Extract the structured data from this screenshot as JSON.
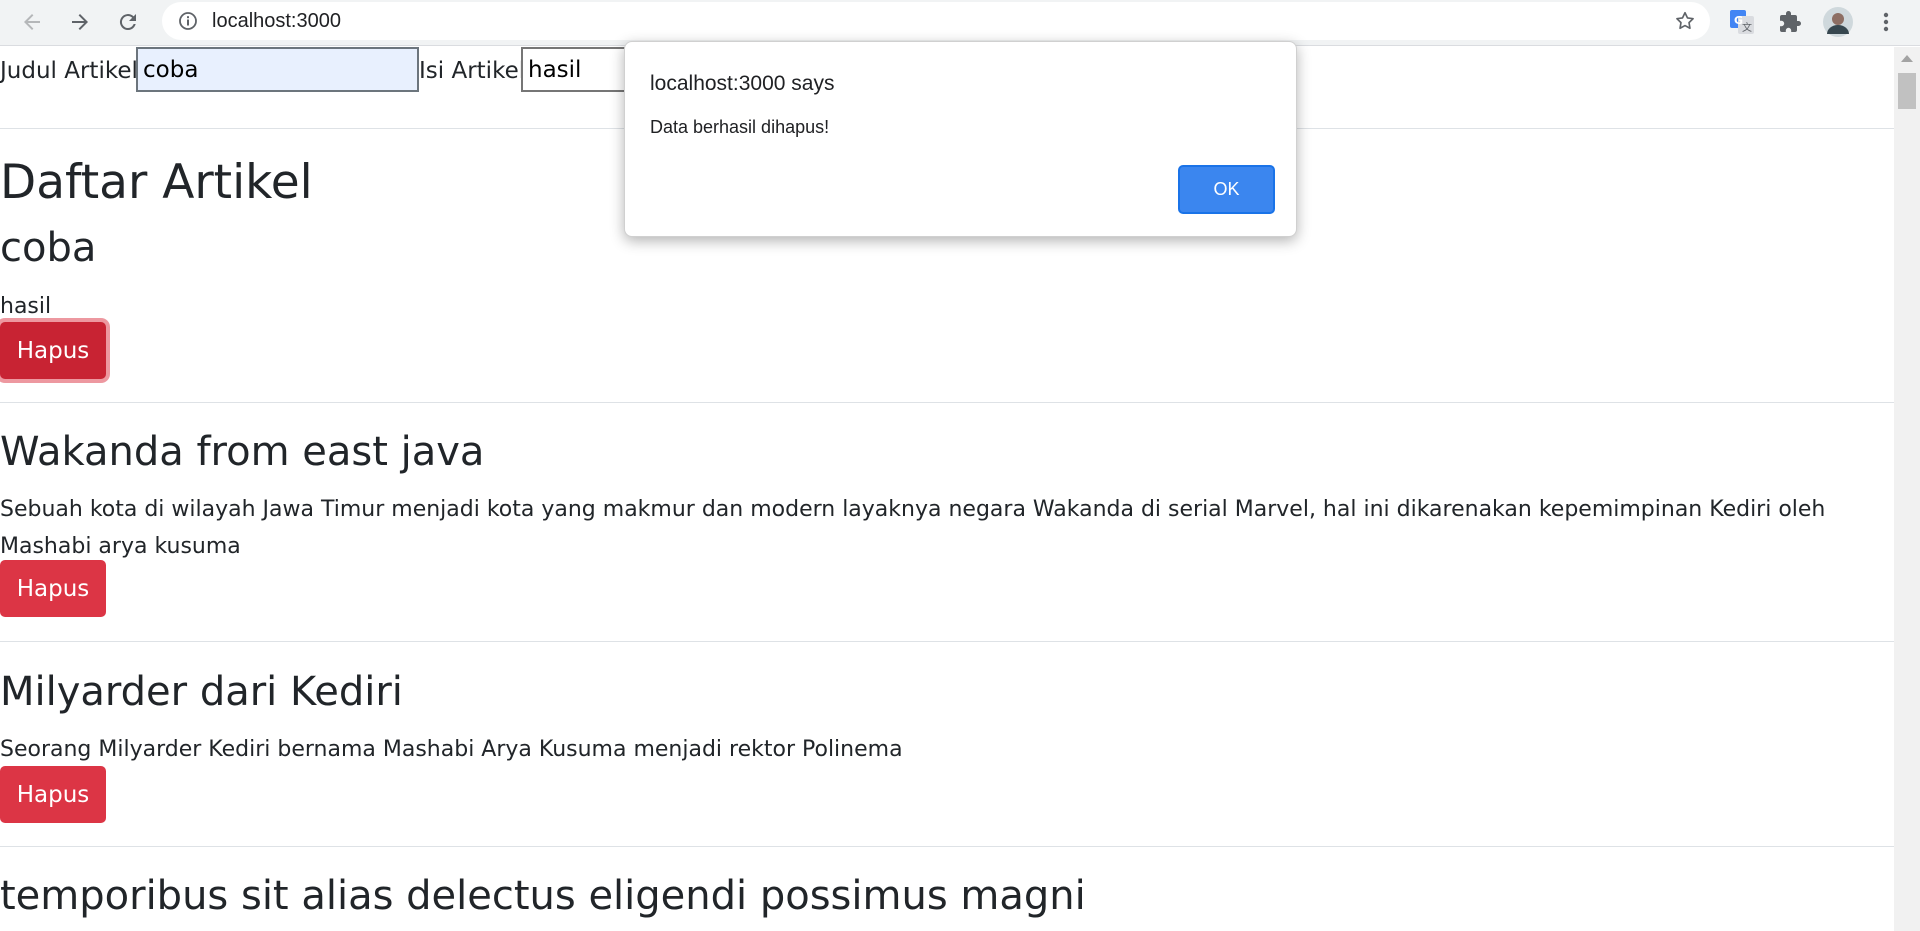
{
  "browser": {
    "url": "localhost:3000",
    "back_icon": "arrow-left-icon",
    "forward_icon": "arrow-right-icon",
    "reload_icon": "reload-icon"
  },
  "form": {
    "title_label": "Judul Artikel:",
    "title_value": "coba",
    "content_label": "Isi Artikel:",
    "content_value": "hasil"
  },
  "main": {
    "heading": "Daftar Artikel",
    "delete_label": "Hapus",
    "articles": [
      {
        "title": "coba",
        "content": "hasil"
      },
      {
        "title": "Wakanda from east java",
        "content": "Sebuah kota di wilayah Jawa Timur menjadi kota yang makmur dan modern layaknya negara Wakanda di serial Marvel, hal ini dikarenakan kepemimpinan Kediri oleh Mashabi arya kusuma"
      },
      {
        "title": "Milyarder dari Kediri",
        "content": "Seorang Milyarder Kediri bernama Mashabi Arya Kusuma menjadi rektor Polinema"
      },
      {
        "title": "temporibus sit alias delectus eligendi possimus magni",
        "content": ""
      }
    ]
  },
  "dialog": {
    "title": "localhost:3000 says",
    "message": "Data berhasil dihapus!",
    "ok_label": "OK"
  },
  "colors": {
    "danger": "#dc3545",
    "dialog_button": "#3b86ef"
  }
}
